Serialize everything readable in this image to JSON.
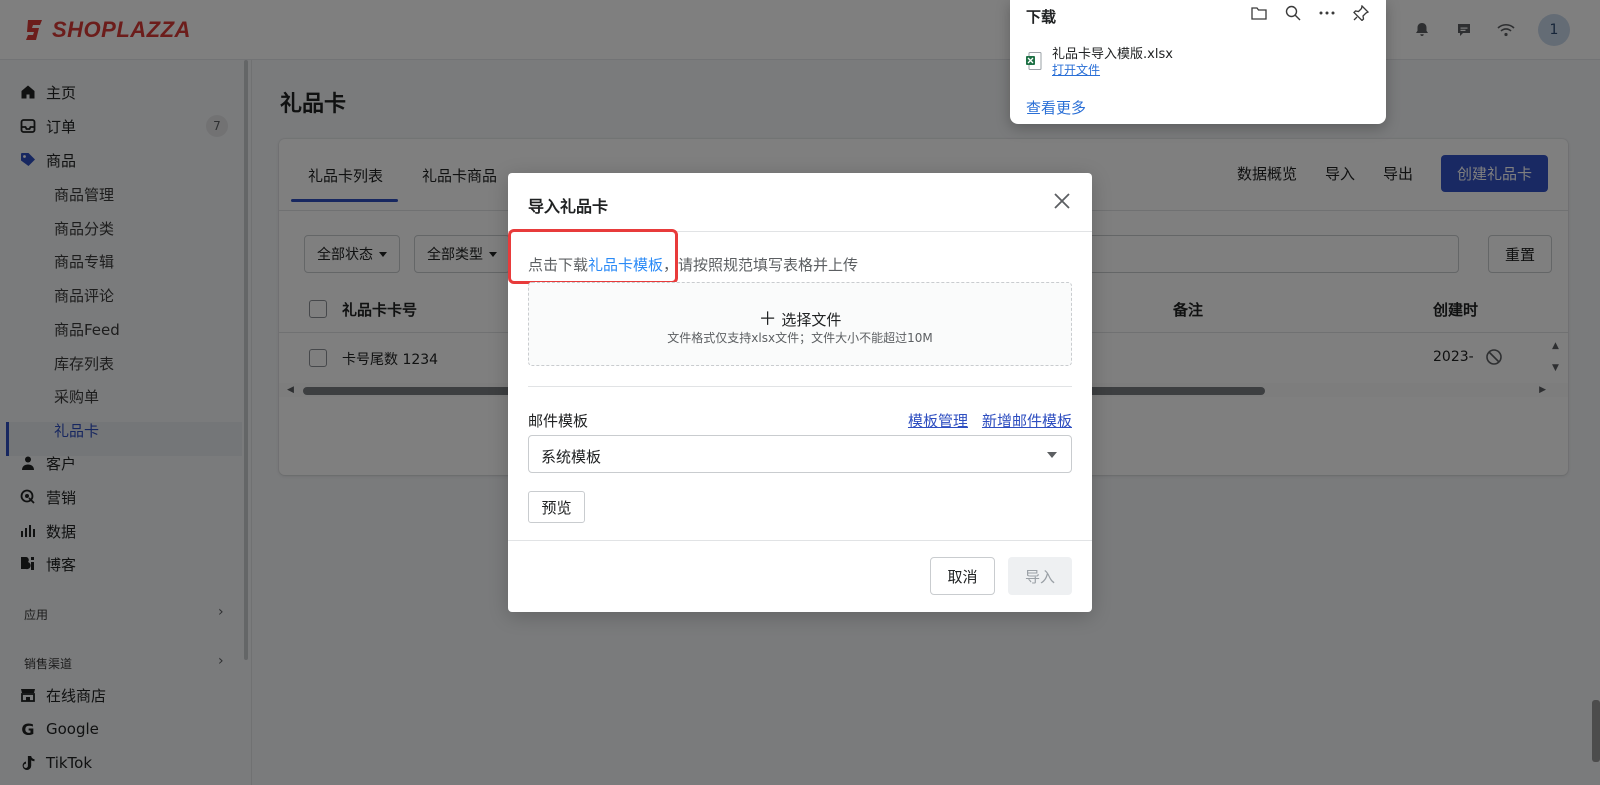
{
  "brand": {
    "name": "SHOPLAZZA",
    "color": "#d83a36"
  },
  "topbar": {
    "icons": [
      "bell-icon",
      "message-icon",
      "wifi-icon"
    ],
    "avatar_label": "1"
  },
  "sidebar": {
    "items": [
      {
        "label": "主页",
        "icon": "home-icon"
      },
      {
        "label": "订单",
        "icon": "inbox-icon",
        "badge": "7"
      },
      {
        "label": "商品",
        "icon": "tag-icon"
      },
      {
        "label": "客户",
        "icon": "person-icon"
      },
      {
        "label": "营销",
        "icon": "marketing-icon"
      },
      {
        "label": "数据",
        "icon": "bar-chart-icon"
      },
      {
        "label": "博客",
        "icon": "blog-icon"
      }
    ],
    "product_sub": [
      "商品管理",
      "商品分类",
      "商品专辑",
      "商品评论",
      "商品Feed",
      "库存列表",
      "采购单",
      "礼品卡"
    ],
    "section_apps": "应用",
    "section_channels": "销售渠道",
    "channels": [
      {
        "label": "在线商店",
        "icon": "store-icon"
      },
      {
        "label": "Google",
        "icon": "google-icon"
      },
      {
        "label": "TikTok",
        "icon": "tiktok-icon"
      }
    ]
  },
  "page": {
    "title": "礼品卡",
    "tabs": [
      "礼品卡列表",
      "礼品卡商品"
    ],
    "actions": {
      "overview": "数据概览",
      "import": "导入",
      "export": "导出",
      "create": "创建礼品卡"
    },
    "filters": {
      "status": "全部状态",
      "type": "全部类型",
      "reset": "重置"
    },
    "table": {
      "headers": [
        "礼品卡卡号",
        "备注",
        "创建时"
      ],
      "rows": [
        {
          "card_no": "卡号尾数 1234",
          "created": "2023-("
        }
      ]
    }
  },
  "modal": {
    "title": "导入礼品卡",
    "hint_prefix": "点击下载",
    "hint_link": "礼品卡模板",
    "hint_suffix": "，请按照规范填写表格并上传",
    "choose_file": "选择文件",
    "file_note": "文件格式仅支持xlsx文件；文件大小不能超过10M",
    "mail_label": "邮件模板",
    "template_manage": "模板管理",
    "new_mail_template": "新增邮件模板",
    "select_value": "系统模板",
    "preview": "预览",
    "cancel": "取消",
    "import": "导入"
  },
  "download_panel": {
    "title": "下载",
    "icons": [
      "folder-icon",
      "search-icon",
      "more-icon",
      "pin-icon"
    ],
    "filename": "礼品卡导入模版.xlsx",
    "open_file": "打开文件",
    "see_more": "查看更多"
  },
  "colors": {
    "primary": "#3352c7",
    "link": "#2a8af6",
    "highlight": "#e83b3b"
  }
}
